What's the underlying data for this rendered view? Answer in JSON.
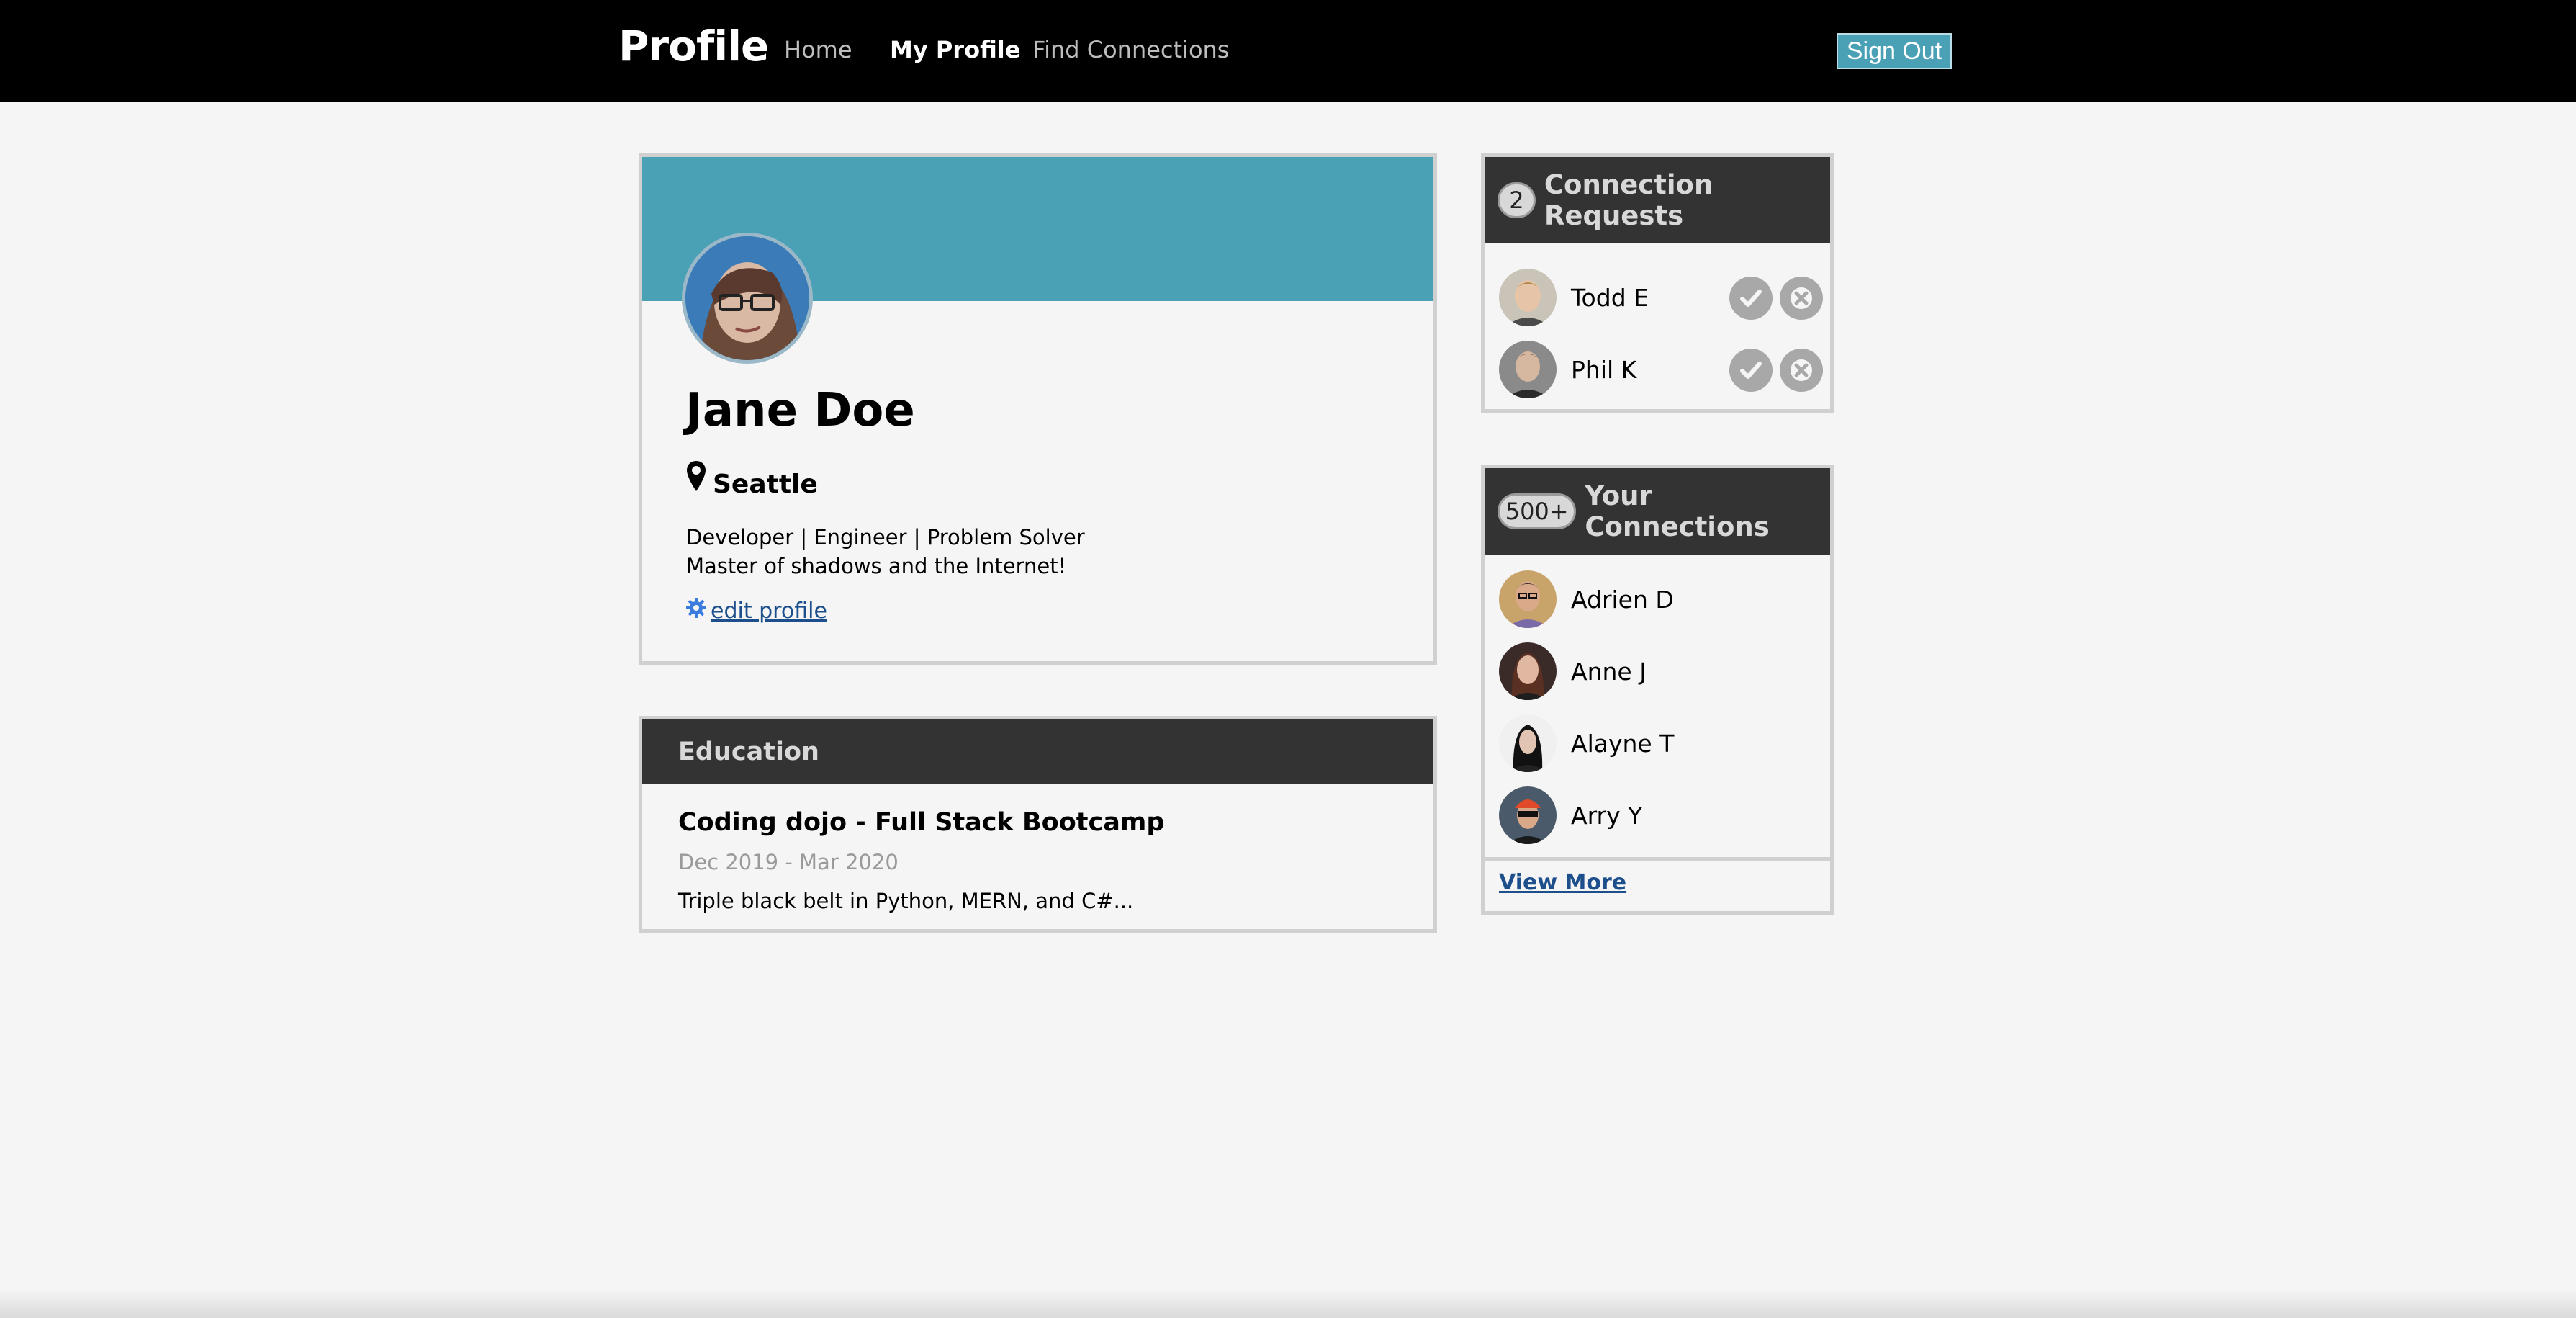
{
  "nav": {
    "brand": "Profile",
    "links": [
      "Home",
      "My Profile",
      "Find Connections"
    ],
    "signout": "Sign Out"
  },
  "profile": {
    "name": "Jane Doe",
    "location": "Seattle",
    "bio_line1": "Developer | Engineer | Problem Solver",
    "bio_line2": "Master of shadows and the Internet!",
    "edit_label": " edit profile"
  },
  "education": {
    "header": "Education",
    "title": "Coding dojo - Full Stack Bootcamp",
    "dates": "Dec 2019 - Mar 2020",
    "description": "Triple black belt in Python, MERN, and C#..."
  },
  "requests": {
    "count": "2",
    "header": "Connection Requests",
    "people": [
      "Todd E",
      "Phil K"
    ]
  },
  "connections": {
    "count": "500+",
    "header": "Your Connections",
    "people": [
      "Adrien D",
      "Anne J",
      "Alayne T",
      "Arry Y"
    ],
    "view_more": "View More"
  },
  "colors": {
    "accent": "#4aa0b5",
    "header_dark": "#333333",
    "link": "#1c4f8c"
  }
}
